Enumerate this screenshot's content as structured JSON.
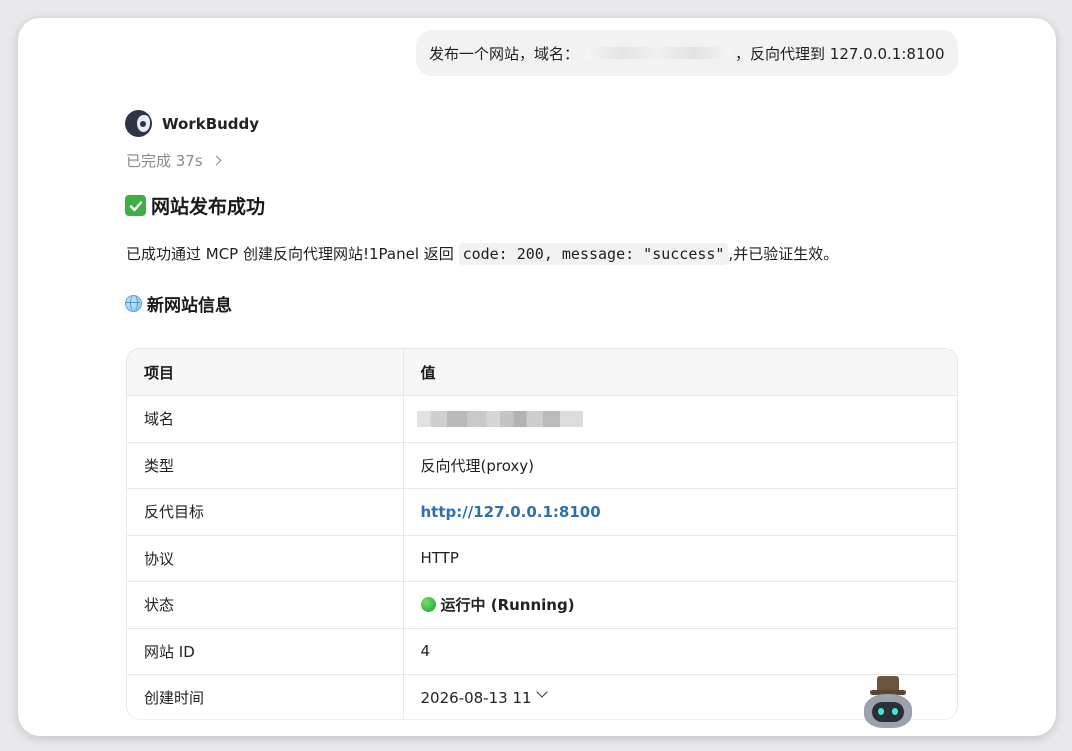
{
  "user_message": {
    "prefix": "发布一个网站，域名：",
    "suffix": "，反向代理到 127.0.0.1:8100"
  },
  "agent": {
    "name": "WorkBuddy",
    "status": "已完成 37s"
  },
  "content": {
    "heading": "网站发布成功",
    "paragraph_before": "已成功通过 MCP 创建反向代理网站!1Panel 返回 ",
    "paragraph_code": "code: 200, message: \"success\"",
    "paragraph_after": ",并已验证生效。",
    "subheading": "新网站信息"
  },
  "table": {
    "headers": [
      "项目",
      "值"
    ],
    "rows": [
      {
        "key": "域名",
        "value": ""
      },
      {
        "key": "类型",
        "value": "反向代理(proxy)"
      },
      {
        "key": "反代目标",
        "value": "http://127.0.0.1:8100"
      },
      {
        "key": "协议",
        "value": "HTTP"
      },
      {
        "key": "状态",
        "value": "运行中 (Running)"
      },
      {
        "key": "网站 ID",
        "value": "4"
      },
      {
        "key": "创建时间",
        "value": "2026-08-13 11"
      }
    ]
  },
  "icons": {
    "check": "check-mark-icon",
    "globe": "globe-icon",
    "status": "green-circle-icon"
  },
  "colors": {
    "link": "#2f6fb0",
    "status_green": "#1f9d28",
    "check_green": "#3cb043"
  }
}
